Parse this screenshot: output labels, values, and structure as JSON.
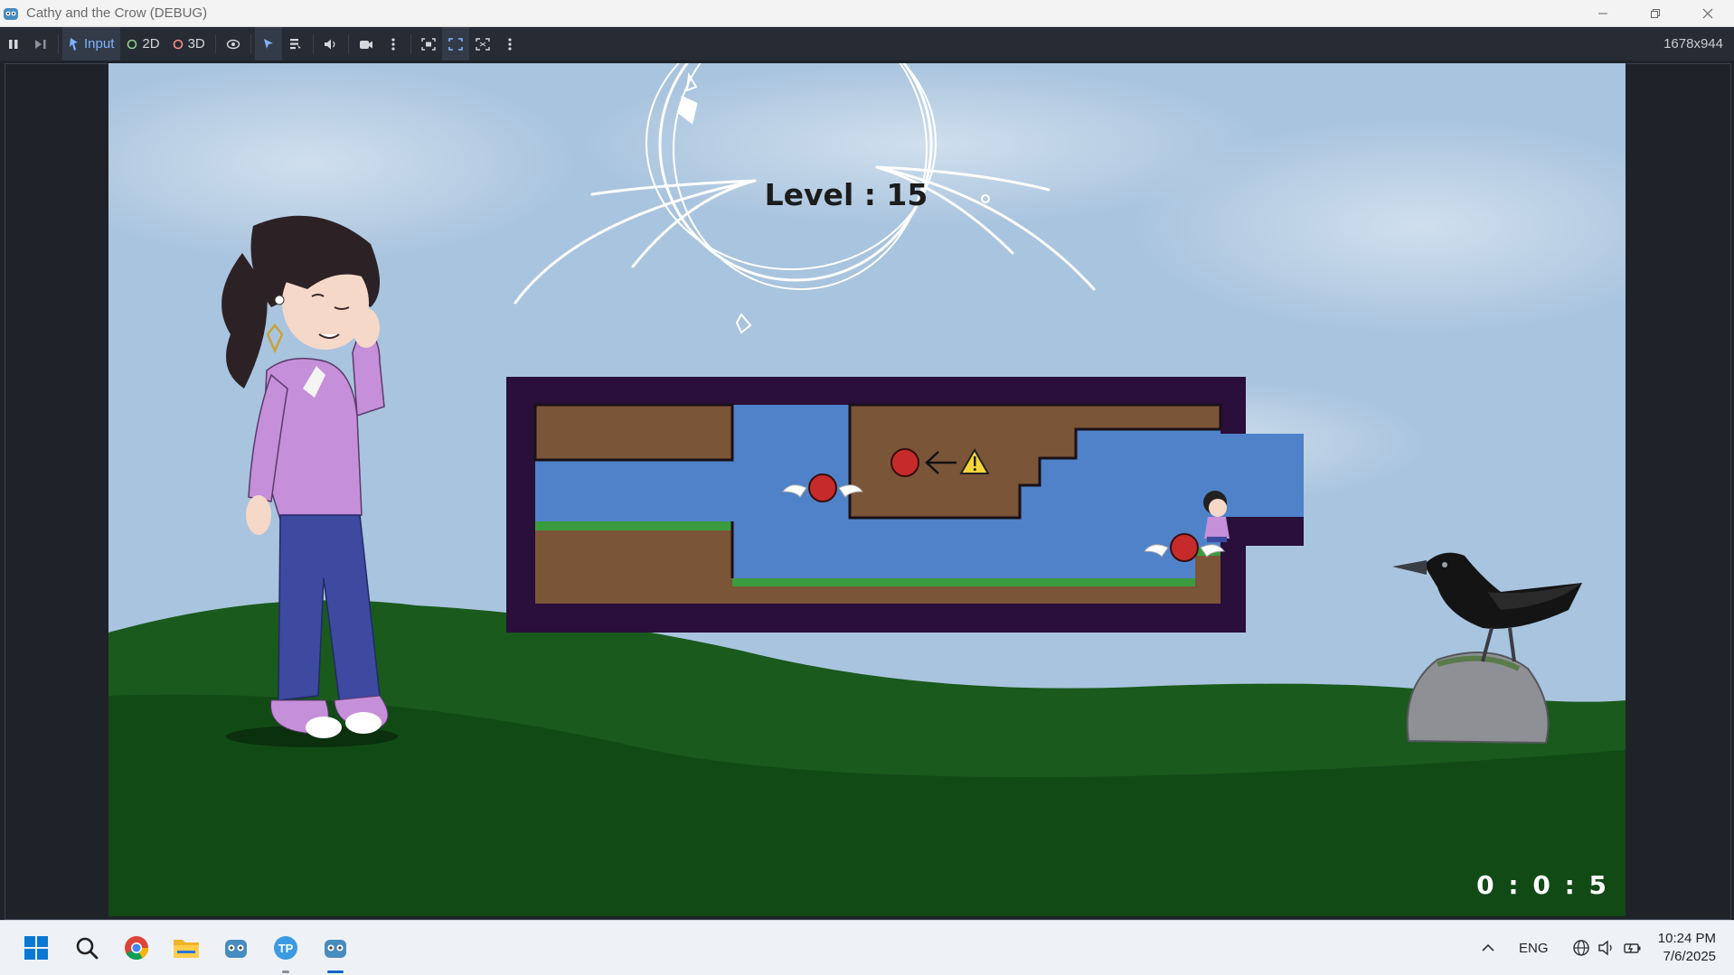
{
  "window": {
    "title": "Cathy and the Crow (DEBUG)",
    "controls": [
      "minimize",
      "restore",
      "close"
    ]
  },
  "toolbar": {
    "input_label": "Input",
    "mode_2d_label": "2D",
    "mode_3d_label": "3D",
    "resolution": "1678x944"
  },
  "game": {
    "level_text": "Level : 15",
    "timer_text": "0 : 0 : 5",
    "colors": {
      "sky": "#a9c4de",
      "grass": "#1a5a1c",
      "frame": "#2a0f3a",
      "dirt": "#7b5537",
      "water": "#4f82c9",
      "ball": "#c62a2a"
    },
    "legend": {
      "from": "red-ball-icon",
      "arrow": "left-arrow-icon",
      "to": "warning-icon"
    },
    "characters": [
      "cathy",
      "crow"
    ]
  },
  "taskbar": {
    "apps": [
      "start-icon",
      "search-icon",
      "chrome-icon",
      "file-explorer-icon",
      "godot-icon",
      "tp-icon",
      "godot-game-icon"
    ],
    "tray": {
      "language": "ENG"
    },
    "clock": {
      "time": "10:24 PM",
      "date": "7/6/2025"
    }
  }
}
